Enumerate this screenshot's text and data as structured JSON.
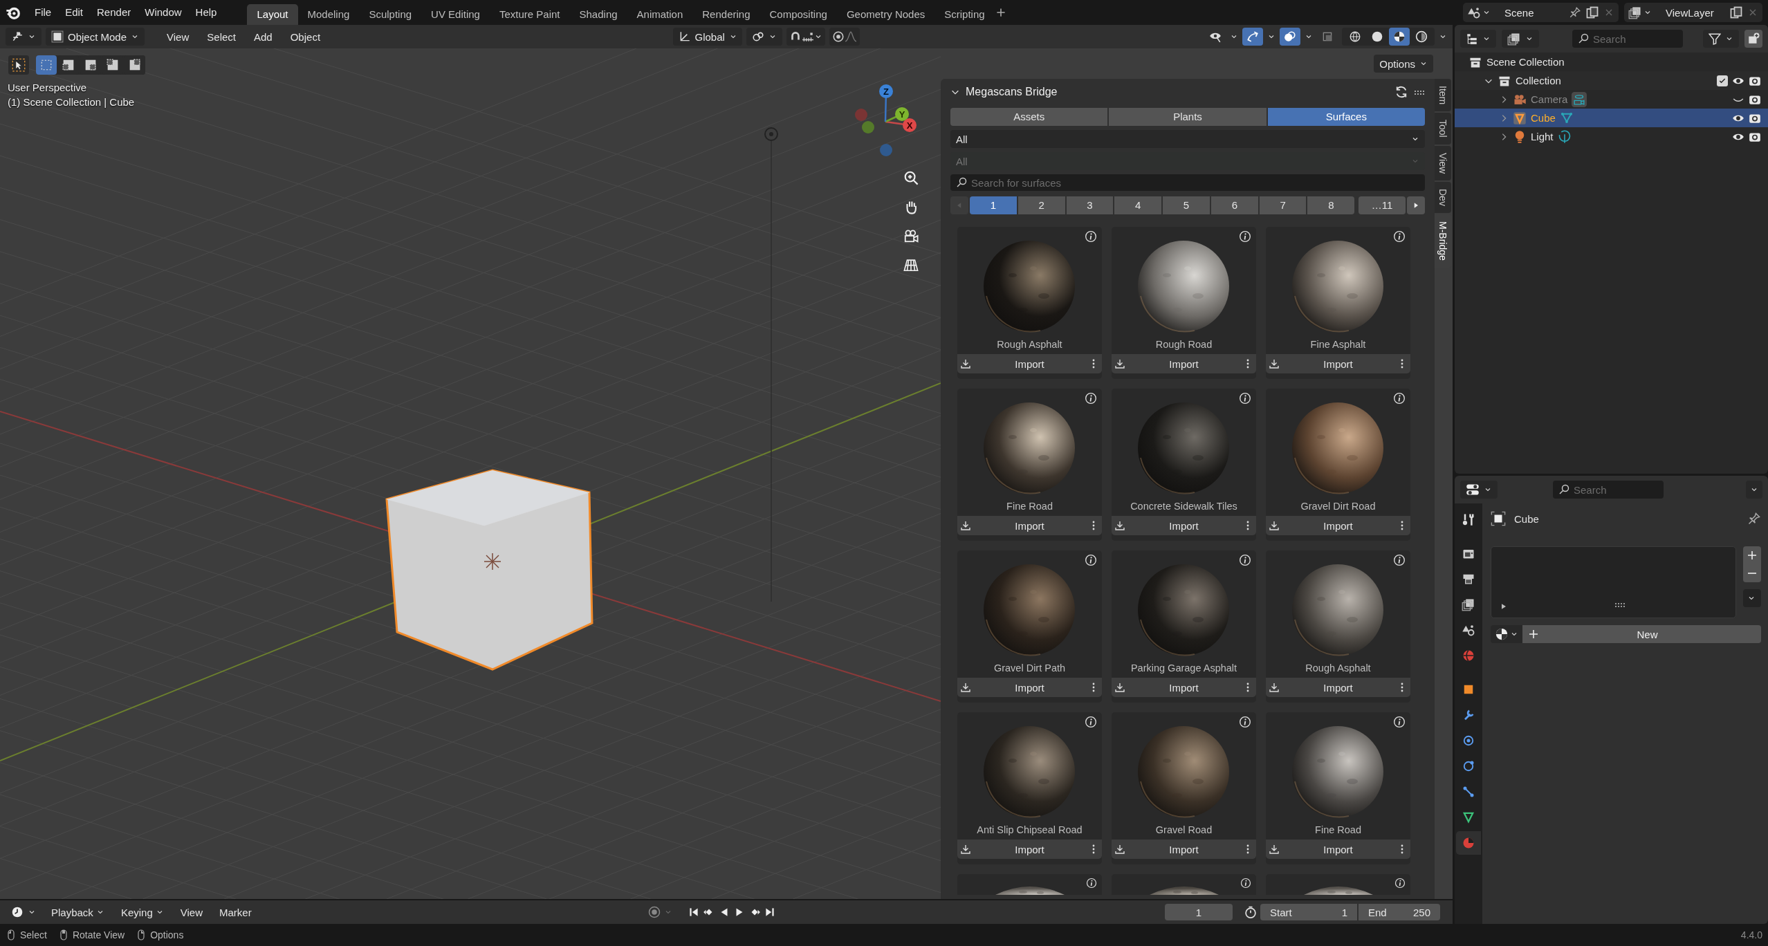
{
  "topbar": {
    "menus": [
      "File",
      "Edit",
      "Render",
      "Window",
      "Help"
    ],
    "workspaces": [
      {
        "label": "Layout",
        "selected": true
      },
      {
        "label": "Modeling",
        "selected": false
      },
      {
        "label": "Sculpting",
        "selected": false
      },
      {
        "label": "UV Editing",
        "selected": false
      },
      {
        "label": "Texture Paint",
        "selected": false
      },
      {
        "label": "Shading",
        "selected": false
      },
      {
        "label": "Animation",
        "selected": false
      },
      {
        "label": "Rendering",
        "selected": false
      },
      {
        "label": "Compositing",
        "selected": false
      },
      {
        "label": "Geometry Nodes",
        "selected": false
      },
      {
        "label": "Scripting",
        "selected": false
      }
    ],
    "scene": "Scene",
    "view_layer": "ViewLayer"
  },
  "viewport": {
    "mode": "Object Mode",
    "menus": [
      "View",
      "Select",
      "Add",
      "Object"
    ],
    "orientation": "Global",
    "snap": {
      "on": false
    },
    "proportional": {
      "on": false
    },
    "toggles": [
      {
        "kind": "visibility",
        "on": false
      },
      {
        "kind": "gizmo",
        "on": true
      },
      {
        "kind": "overlay",
        "on": true
      },
      {
        "kind": "xray",
        "on": false
      }
    ],
    "shading_modes": [
      {
        "kind": "wireframe",
        "selected": false
      },
      {
        "kind": "solid",
        "selected": false
      },
      {
        "kind": "material",
        "selected": true
      },
      {
        "kind": "rendered",
        "selected": false
      }
    ],
    "select_modes": [
      {
        "selected": true
      },
      {
        "selected": false
      },
      {
        "selected": false
      },
      {
        "selected": false
      },
      {
        "selected": false
      }
    ],
    "overlay_text": [
      "User Perspective",
      "(1) Scene Collection | Cube"
    ],
    "gizmo_axes": [
      "X",
      "Y",
      "Z"
    ],
    "options": "Options"
  },
  "sidebar": {
    "title": "Megascans Bridge",
    "expanded": true,
    "categories": [
      {
        "label": "Assets",
        "selected": false
      },
      {
        "label": "Plants",
        "selected": false
      },
      {
        "label": "Surfaces",
        "selected": true
      }
    ],
    "filter": {
      "value": "All",
      "disabled": false
    },
    "subfilter": {
      "value": "All",
      "disabled": true
    },
    "search": {
      "placeholder": "Search for surfaces"
    },
    "pages": [
      {
        "label": "1",
        "selected": true
      },
      {
        "label": "2",
        "selected": false
      },
      {
        "label": "3",
        "selected": false
      },
      {
        "label": "4",
        "selected": false
      },
      {
        "label": "5",
        "selected": false
      },
      {
        "label": "6",
        "selected": false
      },
      {
        "label": "7",
        "selected": false
      },
      {
        "label": "8",
        "selected": false
      },
      {
        "label": "…11",
        "selected": false
      }
    ],
    "cards": [
      {
        "kind": "full",
        "name": "Rough Asphalt",
        "button": "Import"
      },
      {
        "kind": "full",
        "name": "Rough Road",
        "button": "Import"
      },
      {
        "kind": "full",
        "name": "Fine Asphalt",
        "button": "Import"
      },
      {
        "kind": "full",
        "name": "Fine Road",
        "button": "Import"
      },
      {
        "kind": "full",
        "name": "Concrete Sidewalk Tiles",
        "button": "Import"
      },
      {
        "kind": "full",
        "name": "Gravel Dirt Road",
        "button": "Import"
      },
      {
        "kind": "full",
        "name": "Gravel Dirt Path",
        "button": "Import"
      },
      {
        "kind": "full",
        "name": "Parking Garage Asphalt",
        "button": "Import"
      },
      {
        "kind": "full",
        "name": "Rough Asphalt",
        "button": "Import"
      },
      {
        "kind": "full",
        "name": "Anti Slip Chipseal Road",
        "button": "Import"
      },
      {
        "kind": "full",
        "name": "Gravel Road",
        "button": "Import"
      },
      {
        "kind": "full",
        "name": "Fine Road",
        "button": "Import"
      },
      {
        "kind": "cut"
      },
      {
        "kind": "cut"
      },
      {
        "kind": "cut"
      }
    ],
    "tabs": [
      {
        "label": "Item",
        "selected": false
      },
      {
        "label": "Tool",
        "selected": false
      },
      {
        "label": "View",
        "selected": false
      },
      {
        "label": "Dev",
        "selected": false
      },
      {
        "label": "M-Bridge",
        "selected": true
      }
    ]
  },
  "outliner": {
    "search": {
      "placeholder": "Search"
    },
    "tree": [
      {
        "label": "Scene Collection",
        "kind": "scene_collection",
        "selected": false,
        "children": [
          {
            "label": "Collection",
            "kind": "collection",
            "selected": false,
            "expanded": true,
            "checked": true,
            "visible": true,
            "children": [
              {
                "label": "Camera",
                "kind": "camera",
                "selected": false,
                "expanded": false,
                "visible": false
              },
              {
                "label": "Cube",
                "kind": "mesh",
                "selected": true,
                "expanded": false,
                "visible": true
              },
              {
                "label": "Light",
                "kind": "light",
                "selected": false,
                "expanded": false,
                "visible": true
              }
            ]
          }
        ]
      }
    ]
  },
  "properties": {
    "search": {
      "placeholder": "Search"
    },
    "tabs": [
      {
        "kind": "tool",
        "selected": false
      },
      {
        "kind": "render",
        "selected": false
      },
      {
        "kind": "output",
        "selected": false
      },
      {
        "kind": "view_layer",
        "selected": false
      },
      {
        "kind": "scene",
        "selected": false
      },
      {
        "kind": "world",
        "selected": false
      },
      {
        "kind": "object",
        "selected": false
      },
      {
        "kind": "modifier",
        "selected": false
      },
      {
        "kind": "particles",
        "selected": false
      },
      {
        "kind": "physics",
        "selected": false
      },
      {
        "kind": "constraints",
        "selected": false
      },
      {
        "kind": "data",
        "selected": false
      },
      {
        "kind": "material",
        "selected": true
      }
    ],
    "object": "Cube",
    "new_button": "New"
  },
  "timeline": {
    "menus": [
      "Playback",
      "Keying",
      "View",
      "Marker"
    ],
    "current_frame": "1",
    "start_label": "Start",
    "start": "1",
    "end_label": "End",
    "end": "250"
  },
  "status_bar": {
    "hints": [
      "Select",
      "Rotate View",
      "Options"
    ],
    "version": "4.4.0"
  }
}
